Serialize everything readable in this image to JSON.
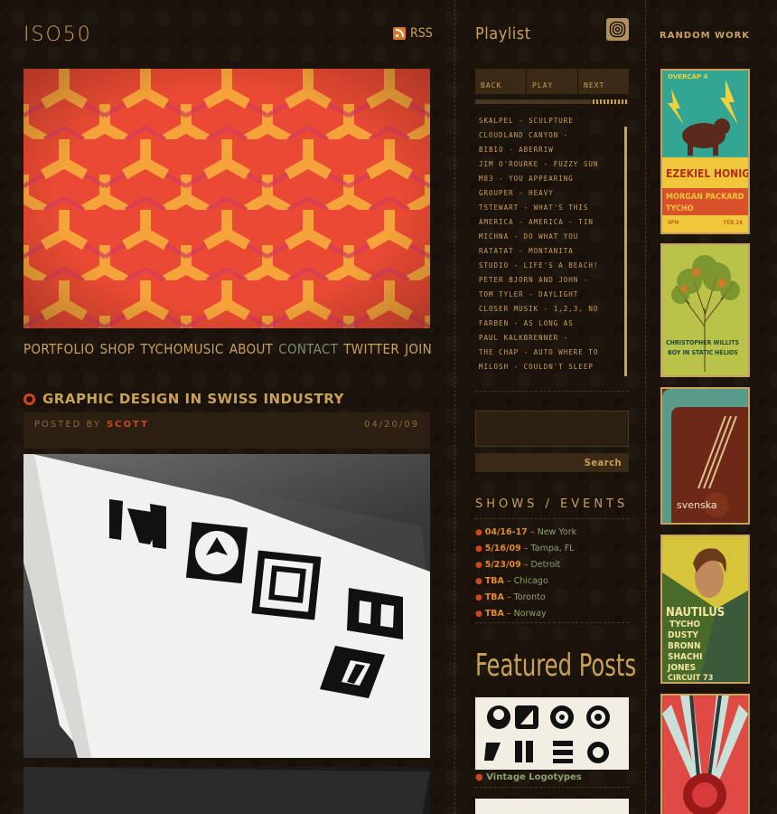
{
  "header": {
    "logo": "ISO50",
    "rss_label": "RSS"
  },
  "nav": {
    "items": [
      {
        "label": "Portfolio"
      },
      {
        "label": "Shop"
      },
      {
        "label": "Tychomusic"
      },
      {
        "label": "About"
      },
      {
        "label": "Contact"
      },
      {
        "label": "Twitter"
      },
      {
        "label": "Join"
      }
    ],
    "active": "Contact"
  },
  "post": {
    "title": "Graphic Design in Swiss Industry",
    "posted_by_label": "Posted by",
    "author": "Scott",
    "date": "04/20/09"
  },
  "playlist": {
    "title": "Playlist",
    "controls": {
      "back": "Back",
      "play": "Play",
      "next": "Next"
    },
    "tracks": [
      "Skalpel - Sculpture",
      "Cloudland Canyon -",
      "Bibio - Aberriw",
      "Jim O'Rourke - Fuzzy Sun",
      "M83 - You Appearing",
      "Grouper - Heavy",
      "Tstewart - What's This",
      "America - America - Tin",
      "Michna - Do What You",
      "Ratatat - Montanita",
      "Studio - Life's A Beach!",
      "Peter Bjorn and John -",
      "Tom Tyler - Daylight",
      "Closer Musik - 1,2,3, No",
      "Farben - As Long As",
      "Paul Kalkbrenner -",
      "The Chap - Auto Where To",
      "Milosh - Couldn't Sleep"
    ]
  },
  "search": {
    "button_label": "Search",
    "value": ""
  },
  "shows": {
    "title": "Shows / Events",
    "items": [
      {
        "date": "04/16-17",
        "city": "New York"
      },
      {
        "date": "5/16/09",
        "city": "Tampa, FL"
      },
      {
        "date": "5/23/09",
        "city": "Detroit"
      },
      {
        "date": "TBA",
        "city": "Chicago"
      },
      {
        "date": "TBA",
        "city": "Toronto"
      },
      {
        "date": "TBA",
        "city": "Norway"
      }
    ]
  },
  "featured": {
    "title": "Featured Posts",
    "items": [
      {
        "caption": "Vintage Logotypes"
      }
    ]
  },
  "random_work": {
    "title": "Random Work",
    "posters": [
      {
        "name": "overcast-poster",
        "lines": [
          "OVERCAP 4",
          "EZEKIEL HONIG",
          "MORGAN PACKARD",
          "TYCHO",
          "FEB 24",
          "9PM"
        ]
      },
      {
        "name": "tree-poster",
        "lines": [
          "CHRISTOPHER WILLITS",
          "BOY IN STATIC",
          "HELIOS"
        ]
      },
      {
        "name": "svenska-poster",
        "lines": [
          "svenska"
        ]
      },
      {
        "name": "nautilus-poster",
        "lines": [
          "NAUTILUS",
          "TYCHO",
          "DUSTY",
          "BRONN",
          "SHACHI",
          "JONES",
          "CIRCUIT 73"
        ]
      },
      {
        "name": "sunburst-poster",
        "lines": []
      }
    ]
  },
  "colors": {
    "background": "#1b130c",
    "gold": "#c8a15a",
    "accent_red": "#d0451f",
    "accent_orange": "#e08a30",
    "city_green": "#8ea06c",
    "nav_active": "#7a8f6a"
  }
}
